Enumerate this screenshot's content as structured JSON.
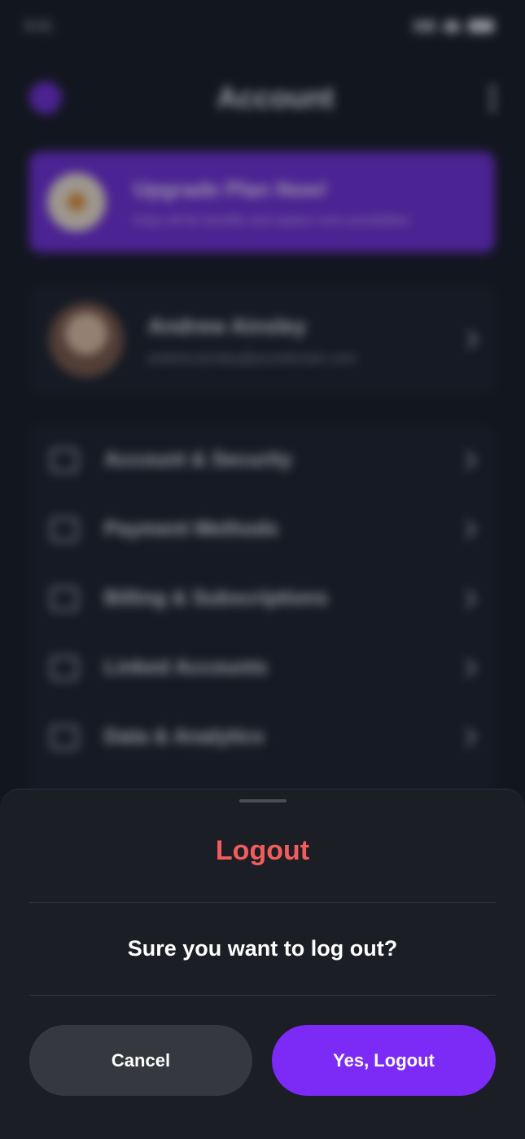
{
  "status_bar": {
    "time": "9:41"
  },
  "header": {
    "title": "Account"
  },
  "upgrade_banner": {
    "title": "Upgrade Plan Now!",
    "subtitle": "Enjoy all the benefits and explore more possibilities"
  },
  "profile": {
    "name": "Andrew Ainsley",
    "email": "andrew.ainsley@yourdomain.com"
  },
  "menu": {
    "items": [
      {
        "label": "Account & Security",
        "icon": "shield-icon"
      },
      {
        "label": "Payment Methods",
        "icon": "card-icon"
      },
      {
        "label": "Billing & Subscriptions",
        "icon": "receipt-icon"
      },
      {
        "label": "Linked Accounts",
        "icon": "swap-icon"
      },
      {
        "label": "Data & Analytics",
        "icon": "chart-icon"
      }
    ]
  },
  "logout_sheet": {
    "title": "Logout",
    "message": "Sure you want to log out?",
    "cancel_label": "Cancel",
    "confirm_label": "Yes, Logout"
  },
  "colors": {
    "accent": "#7b2bf5",
    "danger": "#f15d5d",
    "sheet_bg": "#1c1e25",
    "cancel_bg": "#35383f"
  }
}
